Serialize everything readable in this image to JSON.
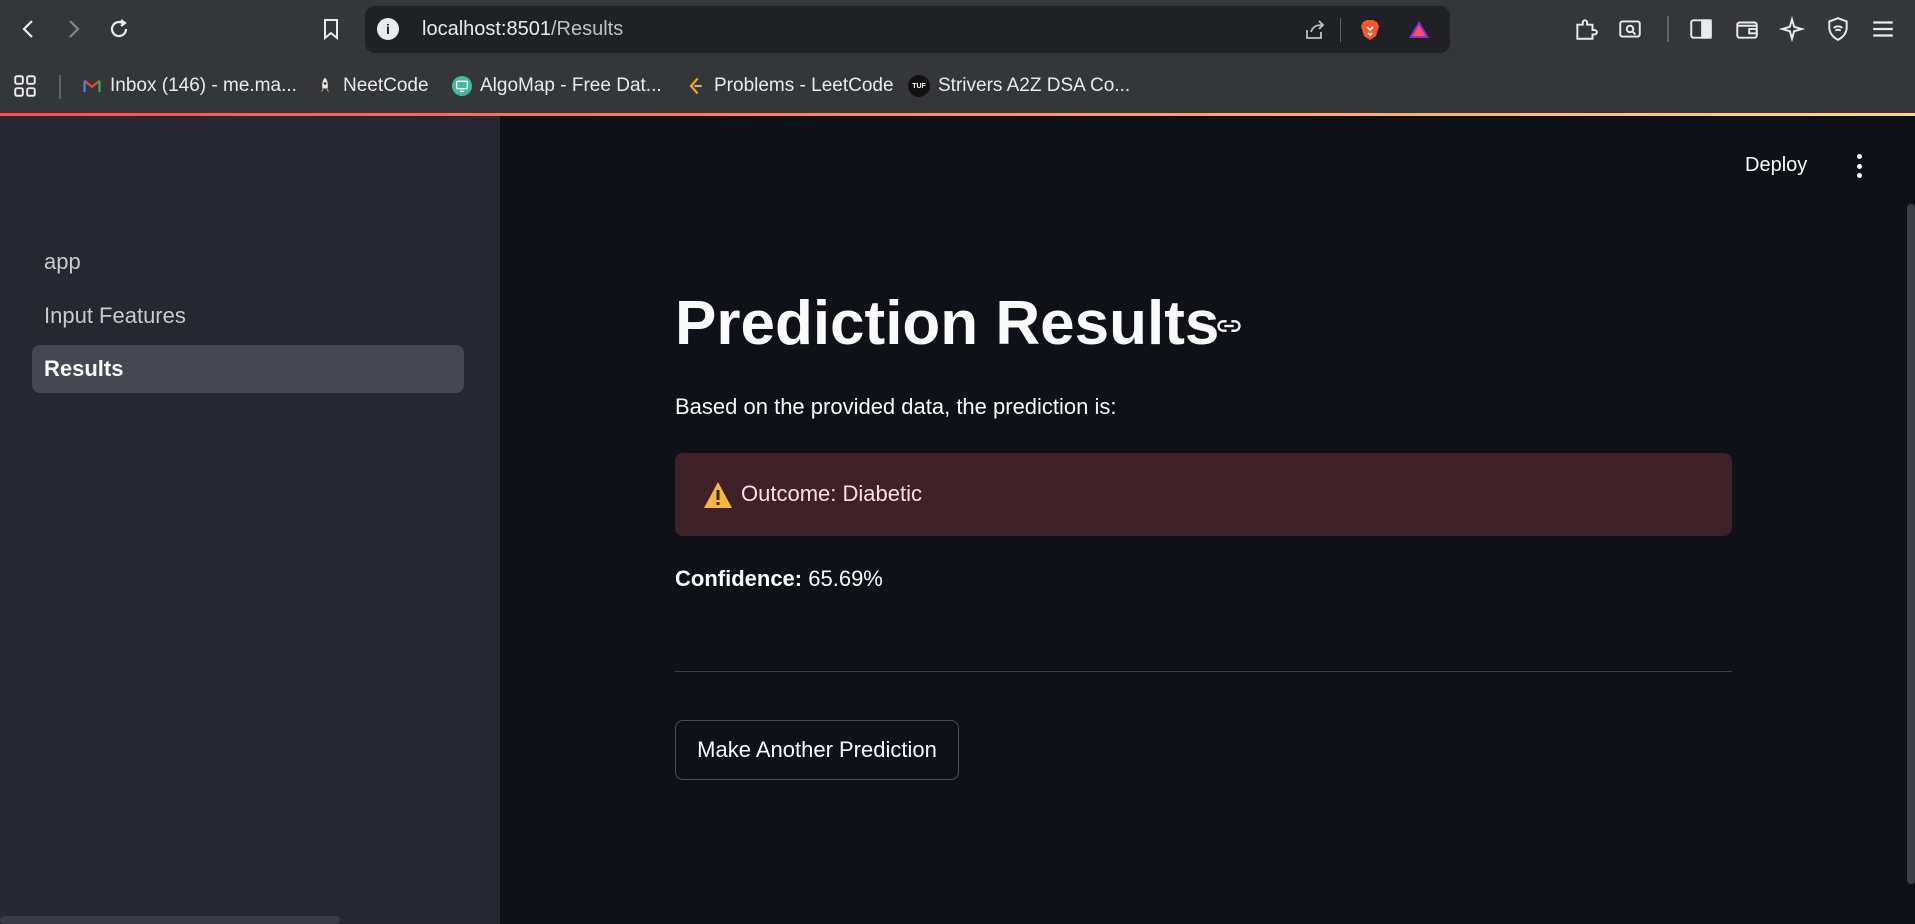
{
  "browser": {
    "url_host": "localhost:8501",
    "url_path": "/Results",
    "bookmarks": [
      {
        "label": "Inbox (146) - me.ma...",
        "icon": "gmail-icon"
      },
      {
        "label": "NeetCode",
        "icon": "rocket-icon"
      },
      {
        "label": "AlgoMap - Free Dat...",
        "icon": "algomap-icon"
      },
      {
        "label": "Problems - LeetCode",
        "icon": "leetcode-icon"
      },
      {
        "label": "Strivers A2Z DSA Co...",
        "icon": "tuf-icon"
      }
    ]
  },
  "sidebar": {
    "items": [
      {
        "label": "app",
        "active": false
      },
      {
        "label": "Input Features",
        "active": false
      },
      {
        "label": "Results",
        "active": true
      }
    ]
  },
  "header": {
    "deploy_label": "Deploy"
  },
  "main": {
    "title": "Prediction Results",
    "subtitle": "Based on the provided data, the prediction is:",
    "alert_text": "Outcome: Diabetic",
    "confidence_label": "Confidence:",
    "confidence_value": "65.69%",
    "button_label": "Make Another Prediction"
  },
  "colors": {
    "accent": "#ff4b4b",
    "alert_bg": "#3e2228",
    "sidebar_bg": "#262730",
    "main_bg": "#0e1117"
  }
}
